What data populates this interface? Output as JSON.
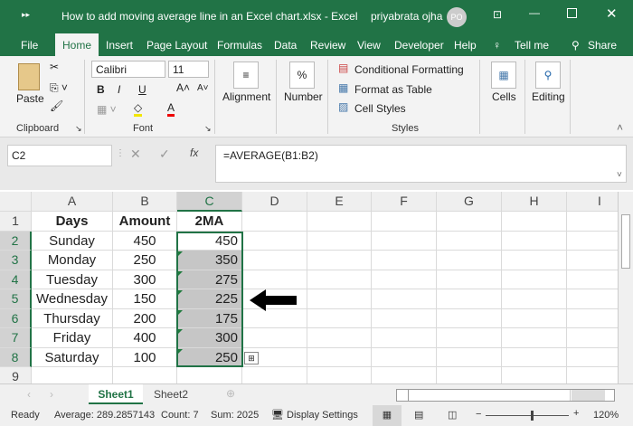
{
  "title": {
    "doc": "How to add moving average line in an Excel chart.xlsx  -  Excel",
    "user": "priyabrata ojha",
    "initials": "PO"
  },
  "tabs": [
    "File",
    "Home",
    "Insert",
    "Page Layout",
    "Formulas",
    "Data",
    "Review",
    "View",
    "Developer",
    "Help",
    "Tell me",
    "Share"
  ],
  "ribbon": {
    "paste": "Paste",
    "clipboard": "Clipboard",
    "font_name": "Calibri",
    "font_size": "11",
    "font": "Font",
    "alignment": "Alignment",
    "number": "Number",
    "cond_fmt": "Conditional Formatting",
    "fmt_table": "Format as Table",
    "cell_styles": "Cell Styles",
    "styles": "Styles",
    "cells": "Cells",
    "editing": "Editing",
    "bold": "B",
    "italic": "I",
    "underline": "U",
    "font_color": "A",
    "percent": "%"
  },
  "formula": {
    "name_box": "C2",
    "fx": "fx",
    "value": "=AVERAGE(B1:B2)"
  },
  "columns": [
    "A",
    "B",
    "C",
    "D",
    "E",
    "F",
    "G",
    "H",
    "I"
  ],
  "rows": [
    [
      "Days",
      "Amount",
      "2MA"
    ],
    [
      "Sunday",
      "450",
      "450"
    ],
    [
      "Monday",
      "250",
      "350"
    ],
    [
      "Tuesday",
      "300",
      "275"
    ],
    [
      "Wednesday",
      "150",
      "225"
    ],
    [
      "Thursday",
      "200",
      "175"
    ],
    [
      "Friday",
      "400",
      "300"
    ],
    [
      "Saturday",
      "100",
      "250"
    ],
    [
      "",
      "",
      ""
    ]
  ],
  "sheets": [
    "Sheet1",
    "Sheet2"
  ],
  "status": {
    "ready": "Ready",
    "average": "Average: 289.2857143",
    "count": "Count: 7",
    "sum": "Sum: 2025",
    "display": "Display Settings",
    "zoom": "120%"
  },
  "colors": {
    "excel_green": "#217346",
    "selection": "#c6c6c6"
  }
}
